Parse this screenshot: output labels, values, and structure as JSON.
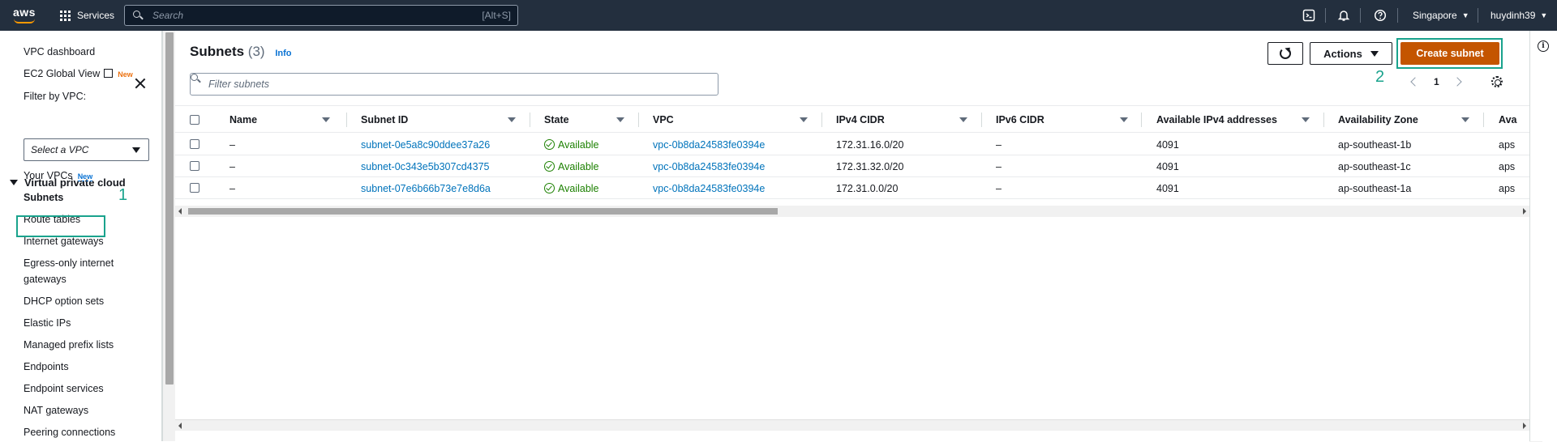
{
  "topbar": {
    "logo_text": "aws",
    "services_label": "Services",
    "search_placeholder": "Search",
    "search_shortcut": "[Alt+S]",
    "icons": [
      "cloudshell-icon",
      "bell-icon",
      "help-icon"
    ],
    "region": "Singapore",
    "user": "huydinh39"
  },
  "sidebar": {
    "dashboard": "VPC dashboard",
    "ec2_global_view": "EC2 Global View",
    "new_badge": "New",
    "filter_label": "Filter by VPC:",
    "filter_select": "Select a VPC",
    "section": "Virtual private cloud",
    "items": [
      {
        "label": "Your VPCs",
        "badge": "New"
      },
      {
        "label": "Subnets"
      },
      {
        "label": "Route tables"
      },
      {
        "label": "Internet gateways"
      },
      {
        "label": "Egress-only internet"
      },
      {
        "label": "gateways"
      },
      {
        "label": "DHCP option sets"
      },
      {
        "label": "Elastic IPs"
      },
      {
        "label": "Managed prefix lists"
      },
      {
        "label": "Endpoints"
      },
      {
        "label": "Endpoint services"
      },
      {
        "label": "NAT gateways"
      },
      {
        "label": "Peering connections"
      }
    ],
    "step_marker": "1"
  },
  "main": {
    "title": "Subnets",
    "count": "(3)",
    "info_label": "Info",
    "filter_placeholder": "Filter subnets",
    "actions_label": "Actions",
    "create_label": "Create subnet",
    "step_marker": "2",
    "page_number": "1",
    "columns": [
      "Name",
      "Subnet ID",
      "State",
      "VPC",
      "IPv4 CIDR",
      "IPv6 CIDR",
      "Available IPv4 addresses",
      "Availability Zone",
      "Ava"
    ],
    "rows": [
      {
        "name": "–",
        "subnet_id": "subnet-0e5a8c90ddee37a26",
        "state": "Available",
        "vpc": "vpc-0b8da24583fe0394e",
        "ipv4": "172.31.16.0/20",
        "ipv6": "–",
        "available": "4091",
        "az": "ap-southeast-1b",
        "extra": "aps"
      },
      {
        "name": "–",
        "subnet_id": "subnet-0c343e5b307cd4375",
        "state": "Available",
        "vpc": "vpc-0b8da24583fe0394e",
        "ipv4": "172.31.32.0/20",
        "ipv6": "–",
        "available": "4091",
        "az": "ap-southeast-1c",
        "extra": "aps"
      },
      {
        "name": "–",
        "subnet_id": "subnet-07e6b66b73e7e8d6a",
        "state": "Available",
        "vpc": "vpc-0b8da24583fe0394e",
        "ipv4": "172.31.0.0/20",
        "ipv6": "–",
        "available": "4091",
        "az": "ap-southeast-1a",
        "extra": "aps"
      }
    ]
  },
  "colors": {
    "topbar": "#232f3e",
    "primary_button": "#c45500",
    "highlight": "#1aa38d",
    "link": "#0073bb",
    "available": "#1d8102"
  }
}
